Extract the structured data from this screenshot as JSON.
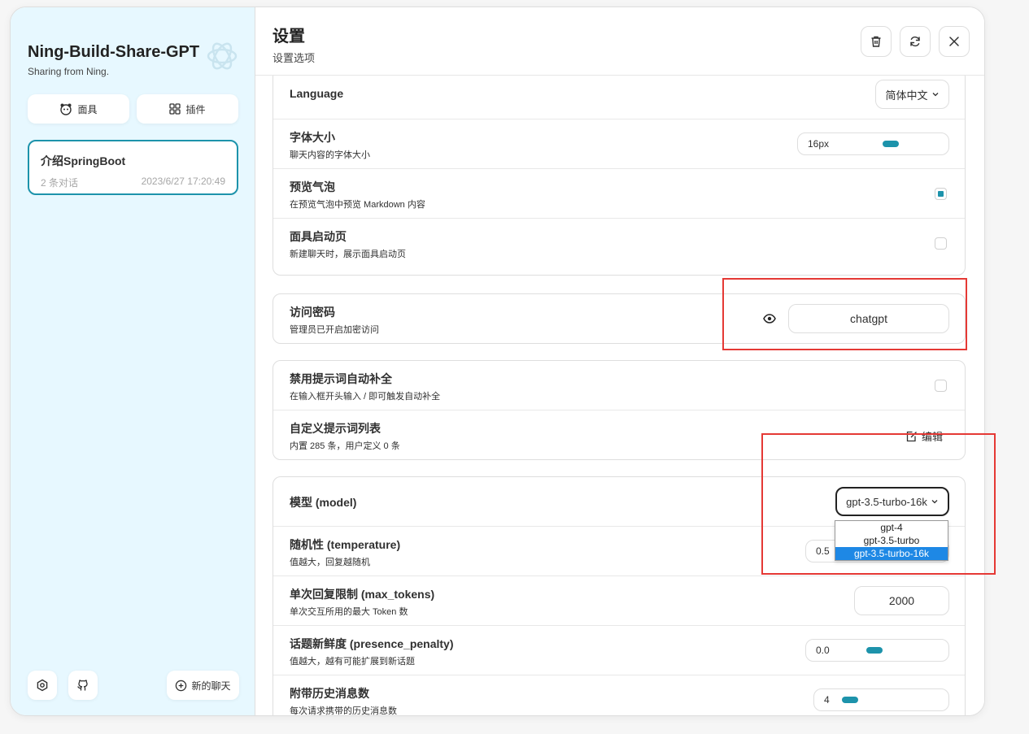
{
  "sidebar": {
    "title": "Ning-Build-Share-GPT",
    "subtitle": "Sharing from Ning.",
    "mask_label": "面具",
    "plugin_label": "插件",
    "chat": {
      "title": "介绍SpringBoot",
      "count": "2 条对话",
      "time": "2023/6/27 17:20:49"
    },
    "new_chat_label": "新的聊天"
  },
  "header": {
    "title": "设置",
    "subtitle": "设置选项"
  },
  "settings": {
    "language": {
      "title": "Language",
      "value": "简体中文"
    },
    "font_size": {
      "title": "字体大小",
      "sub": "聊天内容的字体大小",
      "value": "16px",
      "level": 0.45
    },
    "preview_bubble": {
      "title": "预览气泡",
      "sub": "在预览气泡中预览 Markdown 内容",
      "checked": true
    },
    "mask_launch": {
      "title": "面具启动页",
      "sub": "新建聊天时，展示面具启动页",
      "checked": false
    },
    "access": {
      "title": "访问密码",
      "sub": "管理员已开启加密访问",
      "value": "chatgpt"
    },
    "disable_autocomplete": {
      "title": "禁用提示词自动补全",
      "sub": "在输入框开头输入 / 即可触发自动补全",
      "checked": false
    },
    "custom_prompts": {
      "title": "自定义提示词列表",
      "sub": "内置 285 条，用户定义 0 条",
      "edit_label": "编辑"
    },
    "model": {
      "title": "模型 (model)",
      "value": "gpt-3.5-turbo-16k",
      "options": [
        "gpt-4",
        "gpt-3.5-turbo",
        "gpt-3.5-turbo-16k"
      ],
      "selected_index": 2
    },
    "temperature": {
      "title": "随机性 (temperature)",
      "sub": "值越大，回复越随机",
      "value": "0.5"
    },
    "max_tokens": {
      "title": "单次回复限制 (max_tokens)",
      "sub": "单次交互所用的最大 Token 数",
      "value": "2000"
    },
    "presence_penalty": {
      "title": "话题新鲜度 (presence_penalty)",
      "sub": "值越大，越有可能扩展到新话题",
      "value": "0.0",
      "level": 0.5
    },
    "history_count": {
      "title": "附带历史消息数",
      "sub": "每次请求携带的历史消息数",
      "value": "4",
      "level": 0.1
    }
  },
  "colors": {
    "accent": "#1d93ab",
    "highlight": "#e53935",
    "sidebar_bg": "#e7f8ff"
  }
}
